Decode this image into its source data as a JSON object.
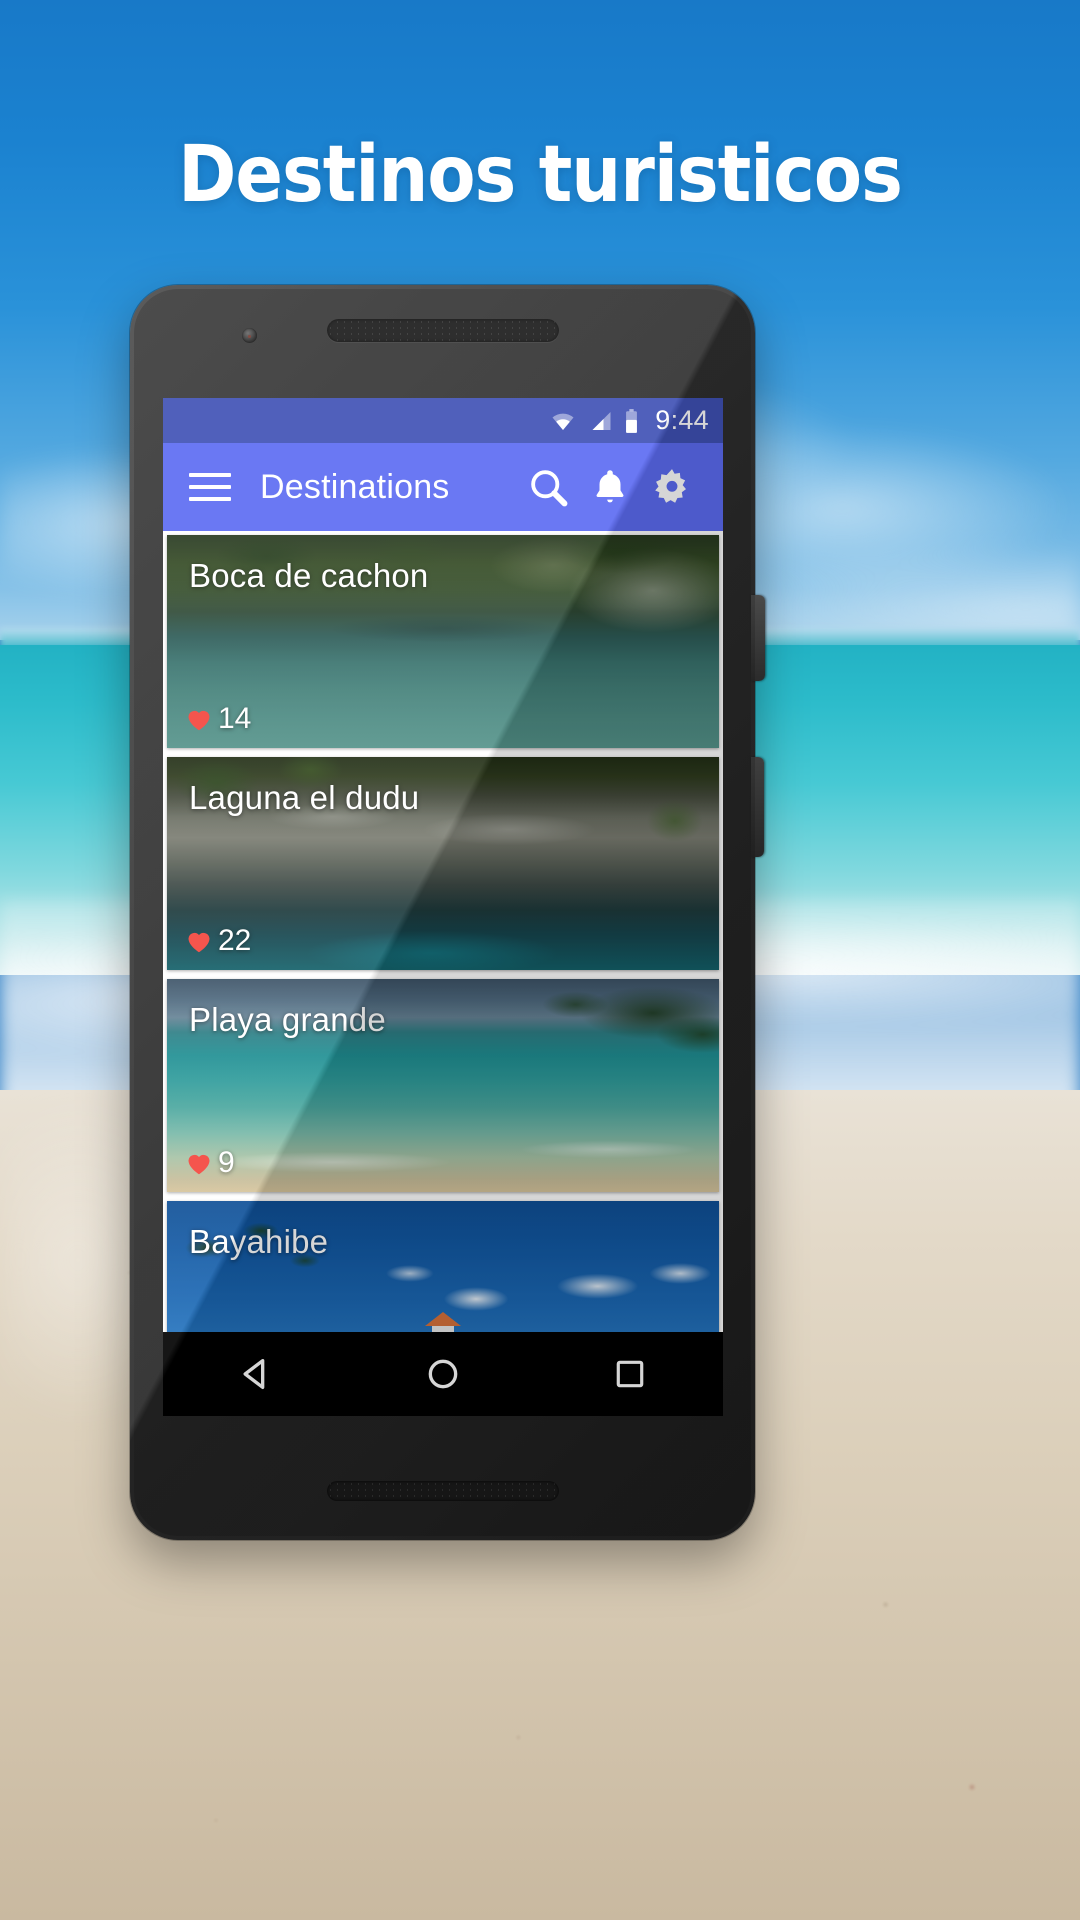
{
  "headline": {
    "text": "Destinos turisticos",
    "color": "#ffffff"
  },
  "theme": {
    "statusbar_color": "#3f51b5",
    "appbar_color": "#5c6bf2",
    "like_heart_color": "#f4453c",
    "navbar_color": "#000000",
    "list_background": "#ffffff"
  },
  "phone": {
    "statusbar": {
      "time": "9:44",
      "icons": [
        "wifi-icon",
        "cell-signal-icon",
        "battery-icon"
      ]
    },
    "appbar": {
      "menu_icon": "hamburger-menu-icon",
      "title": "Destinations",
      "actions": [
        {
          "icon": "search-icon",
          "label": "Search"
        },
        {
          "icon": "bell-icon",
          "label": "Notifications"
        },
        {
          "icon": "gear-icon",
          "label": "Settings"
        }
      ]
    },
    "cards": [
      {
        "title": "Boca de cachon",
        "likes": "14",
        "like_icon": "heart-icon"
      },
      {
        "title": "Laguna el dudu",
        "likes": "22",
        "like_icon": "heart-icon"
      },
      {
        "title": "Playa grande",
        "likes": "9",
        "like_icon": "heart-icon"
      },
      {
        "title": "Bayahibe",
        "likes": "",
        "like_icon": "heart-icon"
      }
    ],
    "navbar": [
      {
        "icon": "back-triangle-icon",
        "label": "Back"
      },
      {
        "icon": "home-circle-icon",
        "label": "Home"
      },
      {
        "icon": "recents-square-icon",
        "label": "Recents"
      }
    ]
  }
}
